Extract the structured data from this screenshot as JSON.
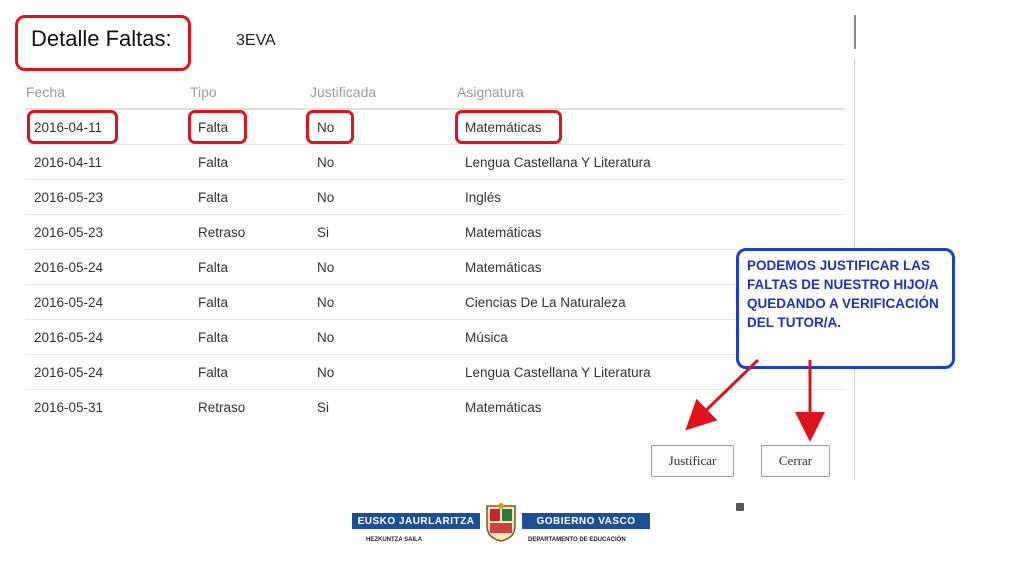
{
  "header": {
    "title": "Detalle Faltas:",
    "period": "3EVA"
  },
  "table": {
    "columns": [
      "Fecha",
      "Tipo",
      "Justificada",
      "Asignatura"
    ],
    "rows": [
      [
        "2016-04-11",
        "Falta",
        "No",
        "Matemáticas"
      ],
      [
        "2016-04-11",
        "Falta",
        "No",
        "Lengua Castellana Y Literatura"
      ],
      [
        "2016-05-23",
        "Falta",
        "No",
        "Inglés"
      ],
      [
        "2016-05-23",
        "Retraso",
        "Si",
        "Matemáticas"
      ],
      [
        "2016-05-24",
        "Falta",
        "No",
        "Matemáticas"
      ],
      [
        "2016-05-24",
        "Falta",
        "No",
        "Ciencias De La Naturaleza"
      ],
      [
        "2016-05-24",
        "Falta",
        "No",
        "Música"
      ],
      [
        "2016-05-24",
        "Falta",
        "No",
        "Lengua Castellana Y Literatura"
      ],
      [
        "2016-05-31",
        "Retraso",
        "Si",
        "Matemáticas"
      ]
    ]
  },
  "buttons": {
    "justify": "Justificar",
    "close": "Cerrar"
  },
  "callout": {
    "text": "PODEMOS JUSTIFICAR LAS FALTAS DE NUESTRO HIJO/A QUEDANDO A VERIFICACIÓN DEL TUTOR/A."
  },
  "logo": {
    "left_text": "EUSKO JAURLARITZA",
    "right_text": "GOBIERNO VASCO",
    "left_sub": "HEZKUNTZA SAILA",
    "right_sub": "DEPARTAMENTO DE EDUCACIÓN"
  },
  "colors": {
    "highlight": "#e0121b",
    "callout": "#1b3fd4",
    "arrow": "#e0121b",
    "logo_bar": "#1e4f92"
  }
}
